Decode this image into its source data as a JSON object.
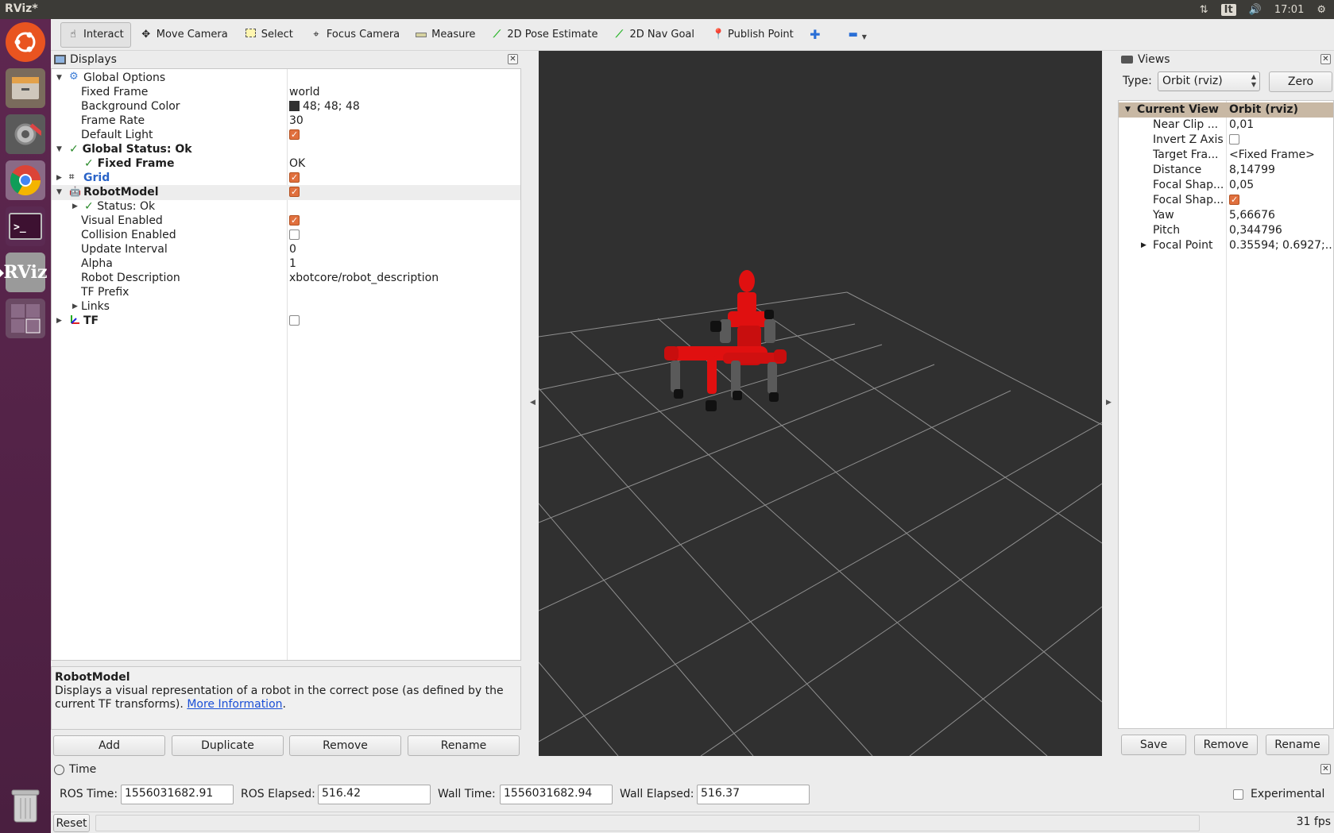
{
  "window": {
    "title": "RViz*"
  },
  "tray": {
    "keyboard": "It",
    "clock": "17:01"
  },
  "launcher": {
    "items": [
      {
        "name": "ubuntu-dash",
        "color": "#e95420"
      },
      {
        "name": "files",
        "color": "#7a6b5c"
      },
      {
        "name": "system-settings",
        "color": "#c84a2a"
      },
      {
        "name": "chrome",
        "color": "#f2f2f2"
      },
      {
        "name": "terminal",
        "color": "#3d1131"
      },
      {
        "name": "rviz",
        "color": "#8d8d8d",
        "label": "RViz"
      },
      {
        "name": "workspace-switcher",
        "color": "#6b4a64"
      },
      {
        "name": "trash",
        "color": "#6b4a64"
      }
    ]
  },
  "toolbar": {
    "interact": "Interact",
    "move_camera": "Move Camera",
    "select": "Select",
    "focus_camera": "Focus Camera",
    "measure": "Measure",
    "pose_estimate": "2D Pose Estimate",
    "nav_goal": "2D Nav Goal",
    "publish_point": "Publish Point"
  },
  "displays": {
    "title": "Displays",
    "global_options": "Global Options",
    "fixed_frame_label": "Fixed Frame",
    "fixed_frame_value": "world",
    "bg_color_label": "Background Color",
    "bg_color_value": "48; 48; 48",
    "frame_rate_label": "Frame Rate",
    "frame_rate_value": "30",
    "default_light_label": "Default Light",
    "global_status": "Global Status: Ok",
    "gs_fixed_frame": "Fixed Frame",
    "gs_fixed_frame_value": "OK",
    "grid": "Grid",
    "robot_model": "RobotModel",
    "rm_status": "Status: Ok",
    "visual_enabled": "Visual Enabled",
    "collision_enabled": "Collision Enabled",
    "update_interval_label": "Update Interval",
    "update_interval_value": "0",
    "alpha_label": "Alpha",
    "alpha_value": "1",
    "robot_desc_label": "Robot Description",
    "robot_desc_value": "xbotcore/robot_description",
    "tf_prefix_label": "TF Prefix",
    "links": "Links",
    "tf": "TF",
    "desc_title": "RobotModel",
    "desc_text": "Displays a visual representation of a robot in the correct pose (as defined by the current TF transforms).",
    "desc_link": "More Information",
    "desc_end": ".",
    "btn_add": "Add",
    "btn_duplicate": "Duplicate",
    "btn_remove": "Remove",
    "btn_rename": "Rename"
  },
  "views": {
    "title": "Views",
    "type_label": "Type:",
    "type_value": "Orbit (rviz)",
    "zero": "Zero",
    "current_view": "Current View",
    "current_view_value": "Orbit (rviz)",
    "near_clip_label": "Near Clip ...",
    "near_clip_value": "0,01",
    "invert_z_label": "Invert Z Axis",
    "target_frame_label": "Target Fra...",
    "target_frame_value": "<Fixed Frame>",
    "distance_label": "Distance",
    "distance_value": "8,14799",
    "focal_shape1_label": "Focal Shap...",
    "focal_shape1_value": "0,05",
    "focal_shape2_label": "Focal Shap...",
    "yaw_label": "Yaw",
    "yaw_value": "5,66676",
    "pitch_label": "Pitch",
    "pitch_value": "0,344796",
    "focal_point_label": "Focal Point",
    "focal_point_value": "0.35594; 0.6927;...",
    "btn_save": "Save",
    "btn_remove": "Remove",
    "btn_rename": "Rename"
  },
  "time": {
    "title": "Time",
    "ros_time_label": "ROS Time:",
    "ros_time_value": "1556031682.91",
    "ros_elapsed_label": "ROS Elapsed:",
    "ros_elapsed_value": "516.42",
    "wall_time_label": "Wall Time:",
    "wall_time_value": "1556031682.94",
    "wall_elapsed_label": "Wall Elapsed:",
    "wall_elapsed_value": "516.37",
    "experimental": "Experimental",
    "reset": "Reset",
    "fps": "31 fps"
  },
  "colors": {
    "viewport_bg": "#303030",
    "robot_red": "#e01010",
    "check_orange": "#e0703e",
    "views_header": "#c8b8a4"
  }
}
